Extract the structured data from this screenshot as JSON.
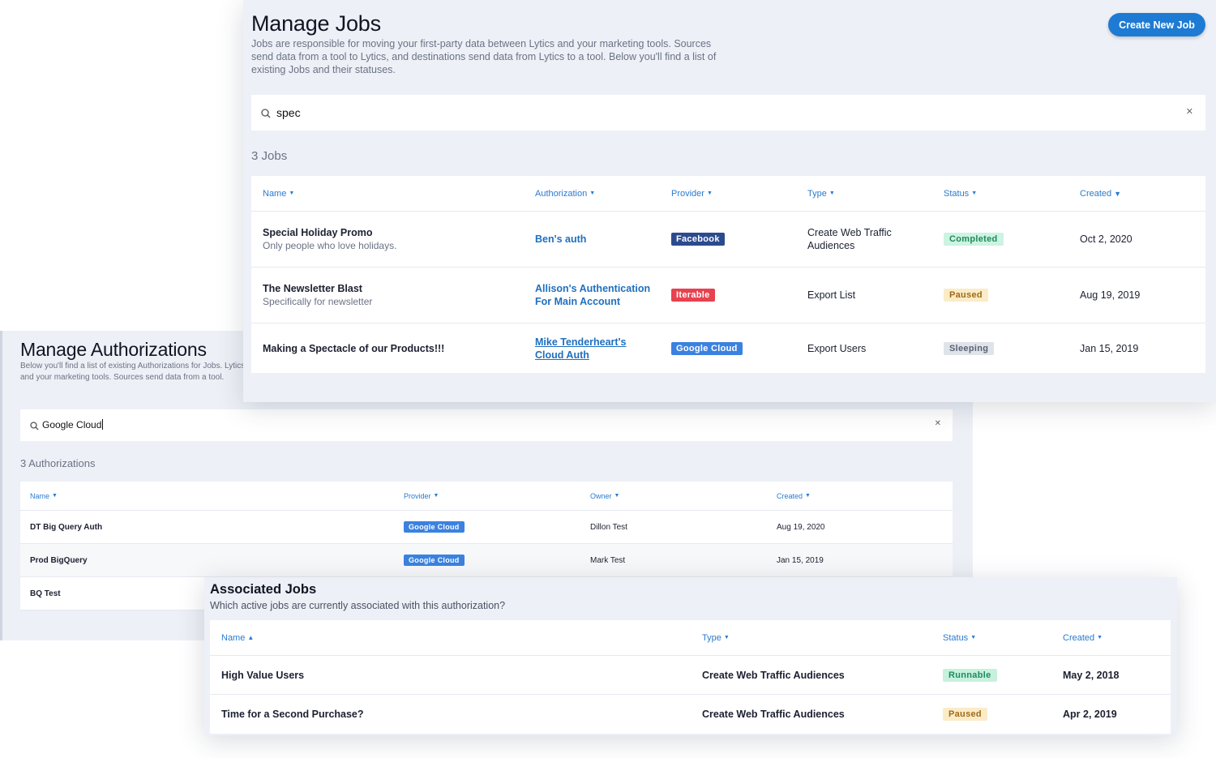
{
  "auth_panel": {
    "title": "Manage Authorizations",
    "description": "Below you'll find a list of existing Authorizations for Jobs. Lytics and your marketing tools. Sources send data from a tool.",
    "search_value": "Google Cloud",
    "count": "3 Authorizations",
    "columns": [
      "Name",
      "Provider",
      "Owner",
      "Created"
    ],
    "rows": [
      {
        "name": "DT Big Query Auth",
        "provider": "Google Cloud",
        "owner": "Dillon Test",
        "created": "Aug 19, 2020"
      },
      {
        "name": "Prod BigQuery",
        "provider": "Google Cloud",
        "owner": "Mark Test",
        "created": "Jan 15, 2019"
      },
      {
        "name": "BQ Test"
      }
    ]
  },
  "jobs_panel": {
    "title": "Manage Jobs",
    "description": "Jobs are responsible for moving your first-party data between Lytics and your marketing tools. Sources send data from a tool to Lytics, and destinations send data from Lytics to a tool. Below you'll find a list of existing Jobs and their statuses.",
    "create_button": "Create New Job",
    "search_value": "spec",
    "count": "3 Jobs",
    "columns": [
      "Name",
      "Authorization",
      "Provider",
      "Type",
      "Status",
      "Created"
    ],
    "rows": [
      {
        "name": "Special Holiday Promo",
        "subtitle": "Only people who love holidays.",
        "authorization": "Ben's auth",
        "provider": "Facebook",
        "type": "Create Web Traffic Audiences",
        "status": "Completed",
        "created": "Oct 2, 2020"
      },
      {
        "name": "The Newsletter Blast",
        "subtitle": "Specifically for newsletter",
        "authorization": "Allison's Authentication For Main Account",
        "provider": "Iterable",
        "type": "Export List",
        "status": "Paused",
        "created": "Aug 19, 2019"
      },
      {
        "name": "Making a Spectacle of our Products!!!",
        "subtitle": "",
        "authorization": "Mike Tenderheart's Cloud Auth",
        "provider": "Google Cloud",
        "type": "Export Users",
        "status": "Sleeping",
        "created": "Jan 15, 2019"
      }
    ]
  },
  "assoc_panel": {
    "title": "Associated Jobs",
    "description": "Which active jobs are currently associated with this authorization?",
    "columns": [
      "Name",
      "Type",
      "Status",
      "Created"
    ],
    "rows": [
      {
        "name": "High Value Users",
        "type": "Create Web Traffic Audiences",
        "status": "Runnable",
        "created": "May 2, 2018"
      },
      {
        "name": "Time for a Second Purchase?",
        "type": "Create Web Traffic Audiences",
        "status": "Paused",
        "created": "Apr 2, 2019"
      }
    ]
  },
  "icons": {
    "search": "search-icon",
    "clear": "close-icon",
    "sort_down": "caret-down-icon",
    "sort_up": "caret-up-icon"
  },
  "colors": {
    "accent": "#1e7bd4",
    "google_cloud": "#3b82e0",
    "facebook": "#2c4a8e",
    "iterable": "#e8414f"
  }
}
